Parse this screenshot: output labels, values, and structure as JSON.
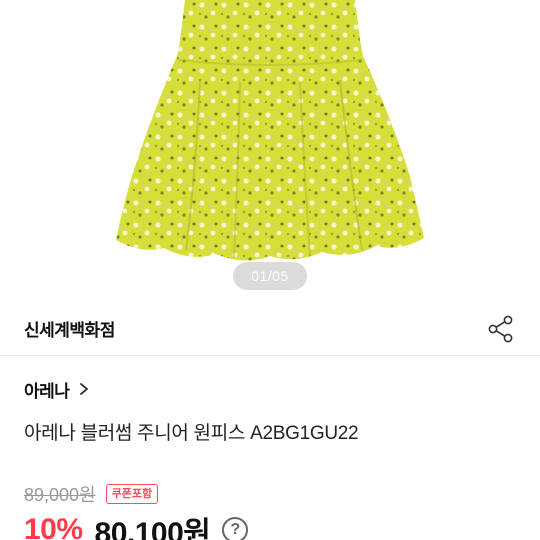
{
  "product_image": {
    "counter": "01/05",
    "alt": "yellow floral dress"
  },
  "store": {
    "name": "신세계백화점",
    "share_icon": "share-icon"
  },
  "brand": {
    "name": "아레나",
    "chevron": "›"
  },
  "product": {
    "title": "아레나 블러썸 주니어 원피스 A2BG1GU22"
  },
  "pricing": {
    "original_price": "89,000원",
    "coupon_badge": "쿠폰포함",
    "discount": "10%",
    "sale_price": "80,100원",
    "help_symbol": "?"
  },
  "colors": {
    "discount_red": "#ff3b4a",
    "dress_yellow": "#d8e23a"
  }
}
